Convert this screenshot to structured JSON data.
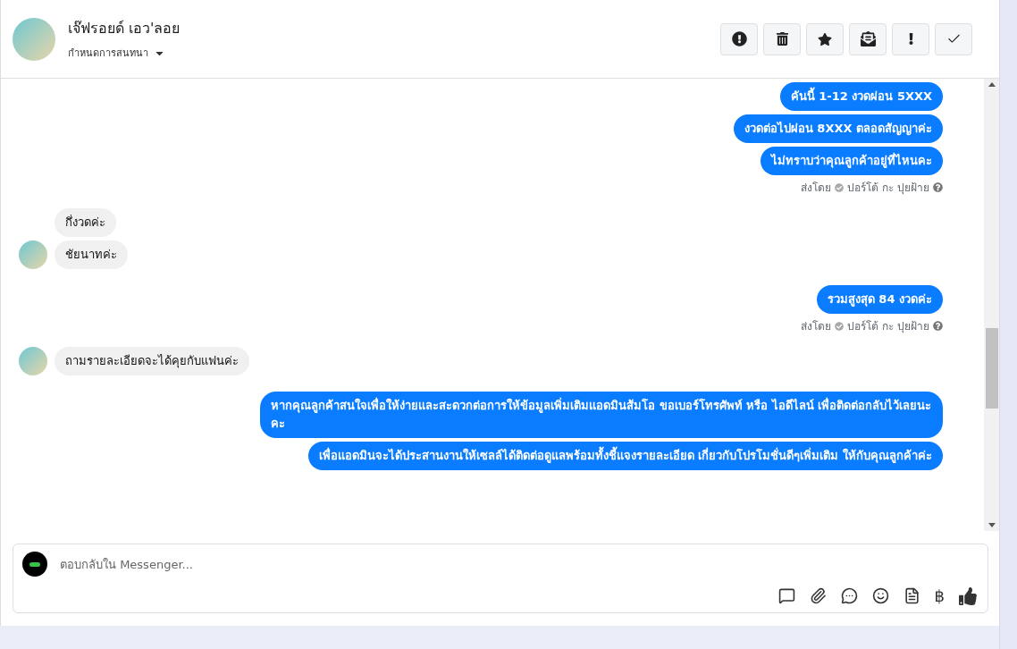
{
  "header": {
    "name": "เจ๊ฟรอยด์ เอว'ลอย",
    "subtitle": "กำหนดการสนทนา"
  },
  "messages": [
    {
      "kind": "out",
      "text": "คันนี้ 1-12 งวดผ่อน 5XXX"
    },
    {
      "kind": "out",
      "text": "งวดต่อไปผ่อน 8XXX ตลอดสัญญาค่ะ"
    },
    {
      "kind": "out",
      "text": "ไม่ทราบว่าคุณลูกค้าอยู่ที่ไหนคะ"
    },
    {
      "kind": "meta",
      "prefix": "ส่งโดย",
      "sender": "ปอร์โต้ กะ ปุยฝ้าย"
    },
    {
      "kind": "in",
      "text": "กึ่งวดค่ะ",
      "show_avatar": false
    },
    {
      "kind": "in",
      "text": "ชัยนาทค่ะ",
      "show_avatar": true
    },
    {
      "kind": "out",
      "text": "รวมสูงสุด 84 งวดค่ะ"
    },
    {
      "kind": "meta",
      "prefix": "ส่งโดย",
      "sender": "ปอร์โต้ กะ ปุยฝ้าย"
    },
    {
      "kind": "in",
      "text": "ถามรายละเอียดจะได้คุยกับแฟนค่ะ",
      "show_avatar": true
    },
    {
      "kind": "out",
      "text": "หากคุณลูกค้าสนใจเพื่อให้ง่ายและสะดวกต่อการให้ข้อมูลเพิ่มเติมแอดมินส้มโอ ขอเบอร์โทรศัพท์ หรือ ไอดีไลน์ เพื่อติดต่อกลับไว้เลยนะคะ"
    },
    {
      "kind": "out",
      "text": "เพื่อแอดมินจะได้ประสานงานให้เซลล์ได้ติดต่อดูแลพร้อมทั้งชี้แจงรายละเอียด เกี่ยวกับโปรโมชั่นดีๆเพิ่มเติม ให้กับคุณลูกค้าค่ะ"
    }
  ],
  "composer": {
    "placeholder": "ตอบกลับใน Messenger...",
    "currency_symbol": "฿"
  }
}
